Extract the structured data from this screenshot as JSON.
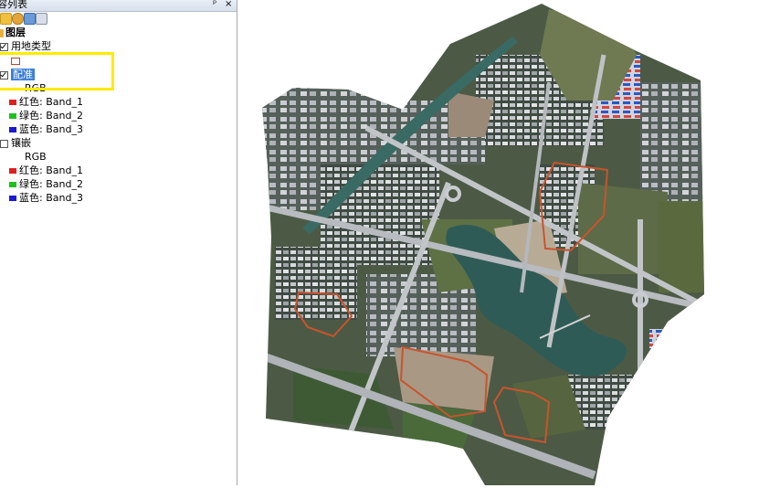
{
  "toc": {
    "title": "容列表",
    "pin_glyph": "ᵖ",
    "close_glyph": "×",
    "root_label": "图层",
    "layers": [
      {
        "name": "用地类型",
        "checked": true
      },
      {
        "name": "配准",
        "checked": true,
        "selected": true,
        "render": "RGB",
        "bands": [
          {
            "label": "红色:   Band_1",
            "color": "#e02020"
          },
          {
            "label": "绿色: Band_2",
            "color": "#20c020"
          },
          {
            "label": "蓝色:   Band_3",
            "color": "#1a1ad0"
          }
        ]
      },
      {
        "name": "镶嵌",
        "checked": false,
        "render": "RGB",
        "bands": [
          {
            "label": "红色:   Band_1",
            "color": "#e02020"
          },
          {
            "label": "绿色: Band_2",
            "color": "#20c020"
          },
          {
            "label": "蓝色:   Band_3",
            "color": "#1a1ad0"
          }
        ]
      }
    ]
  },
  "colors": {
    "highlight_box": "#ffea00",
    "selection": "#3b7fd9",
    "boundary": "#c8542e"
  }
}
